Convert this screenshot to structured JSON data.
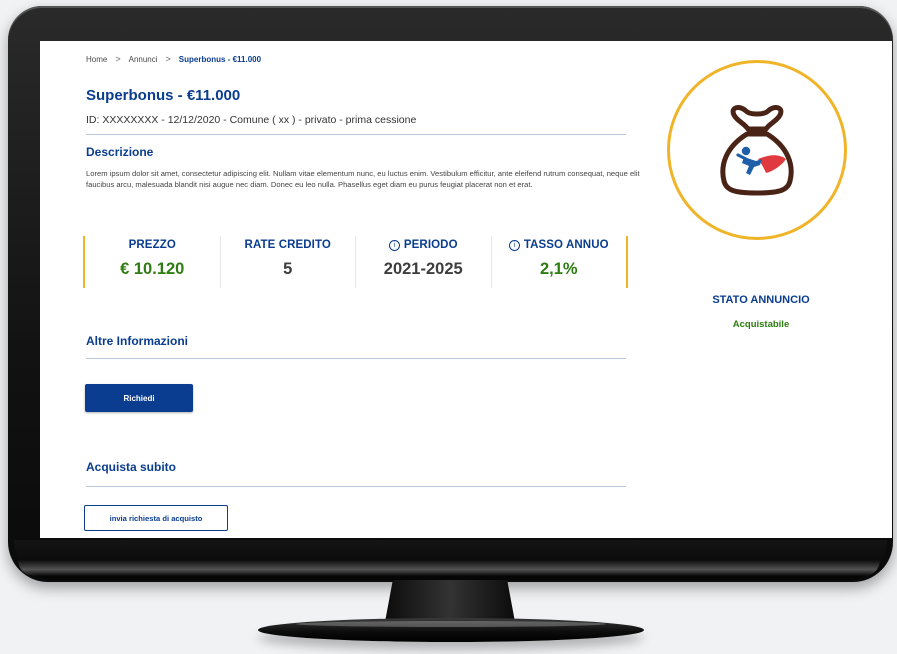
{
  "breadcrumb": {
    "home": "Home",
    "section": "Annunci",
    "current": "Superbonus - €11.000",
    "separator": ">"
  },
  "listing": {
    "title": "Superbonus - €11.000",
    "subtitle": "ID: XXXXXXXX - 12/12/2020 - Comune ( xx ) - privato - prima cessione"
  },
  "description": {
    "heading": "Descrizione",
    "text": "Lorem ipsum dolor sit amet, consectetur adipiscing elit. Nullam vitae elementum nunc, eu luctus enim. Vestibulum efficitur, ante eleifend rutrum consequat, neque elit faucibus arcu, malesuada blandit nisi augue nec diam.  Donec eu leo nulla. Phasellus eget diam eu purus feugiat placerat non et erat."
  },
  "stats": [
    {
      "label": "PREZZO",
      "value": "€ 10.120",
      "info": false
    },
    {
      "label": "RATE CREDITO",
      "value": "5",
      "info": false
    },
    {
      "label": "PERIODO",
      "value": "2021-2025",
      "info": true
    },
    {
      "label": "TASSO ANNUO",
      "value": "2,1%",
      "info": true
    }
  ],
  "info_icon_glyph": "i",
  "other_info": {
    "heading": "Altre Informazioni",
    "button_label": "Richiedi"
  },
  "buy_now": {
    "heading": "Acquista subito",
    "button_label": "invia richiesta di acquisto"
  },
  "status": {
    "label": "STATO ANNUNCIO",
    "value": "Acquistabile",
    "icon": "money-bag-superhero-icon"
  },
  "colors": {
    "primary_blue": "#0a3d8f",
    "accent_gold": "#f0b429",
    "value_green": "#2e7d12",
    "bag_brown": "#4a2317",
    "hero_red": "#e03a3e",
    "hero_blue": "#1f5fa8"
  }
}
